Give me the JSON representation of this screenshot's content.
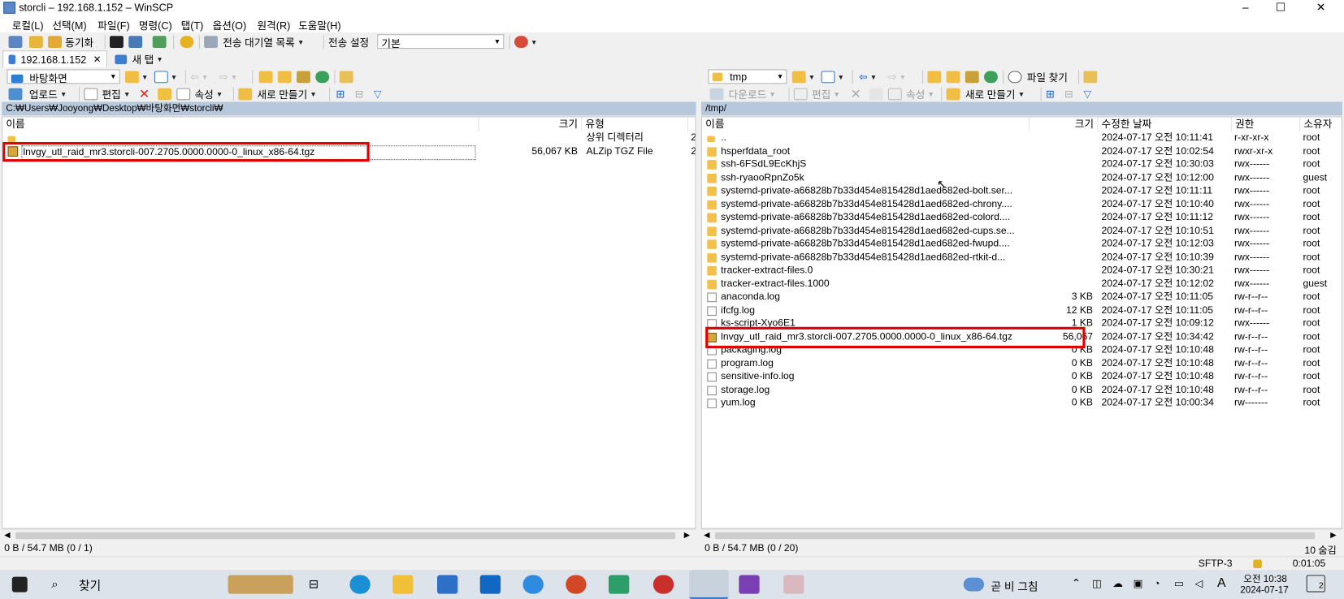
{
  "window": {
    "title": "storcli – 192.168.1.152 – WinSCP",
    "min": "–",
    "max": "☐",
    "close": "✕"
  },
  "menu": [
    "로컬(L)",
    "선택(M)",
    "파일(F)",
    "명령(C)",
    "탭(T)",
    "옵션(O)",
    "원격(R)",
    "도움말(H)"
  ],
  "toolbar": {
    "sync_label": "동기화",
    "queue_label": "전송 대기열 목록",
    "transfer_settings_label": "전송 설정",
    "transfer_settings_value": "기본"
  },
  "tabs": {
    "session": "192.168.1.152",
    "session_close": "✕",
    "new_tab": "새 탭"
  },
  "left": {
    "location": "바탕화면",
    "upload_label": "업로드",
    "edit_label": "편집",
    "properties_label": "속성",
    "new_label": "새로 만들기",
    "path": "C:₩Users₩Jooyong₩Desktop₩바탕화면₩storcli₩",
    "columns": {
      "name": "이름",
      "size": "크기",
      "type": "유형",
      "extra": ""
    },
    "rows": [
      {
        "name": "",
        "size": "",
        "type": "상위 디렉터리",
        "extra": "2",
        "icon": "parent"
      },
      {
        "name": "lnvgy_utl_raid_mr3.storcli-007.2705.0000.0000-0_linux_x86-64.tgz",
        "size": "56,067 KB",
        "type": "ALZip TGZ File",
        "extra": "2",
        "icon": "tgz"
      }
    ],
    "status": "0 B / 54.7 MB (0 / 1)"
  },
  "right": {
    "location": "tmp",
    "download_label": "다운로드",
    "edit_label": "편집",
    "properties_label": "속성",
    "new_label": "새로 만들기",
    "find_label": "파일 찾기",
    "path": "/tmp/",
    "columns": {
      "name": "이름",
      "size": "크기",
      "modified": "수정한 날짜",
      "rights": "권한",
      "owner": "소유자"
    },
    "rows": [
      {
        "name": "..",
        "size": "",
        "modified": "2024-07-17 오전 10:11:41",
        "rights": "r-xr-xr-x",
        "owner": "root",
        "icon": "parent"
      },
      {
        "name": "hsperfdata_root",
        "size": "",
        "modified": "2024-07-17 오전 10:02:54",
        "rights": "rwxr-xr-x",
        "owner": "root",
        "icon": "folder"
      },
      {
        "name": "ssh-6FSdL9EcKhjS",
        "size": "",
        "modified": "2024-07-17 오전 10:30:03",
        "rights": "rwx------",
        "owner": "root",
        "icon": "folder"
      },
      {
        "name": "ssh-ryaooRpnZo5k",
        "size": "",
        "modified": "2024-07-17 오전 10:12:00",
        "rights": "rwx------",
        "owner": "guest",
        "icon": "folder"
      },
      {
        "name": "systemd-private-a66828b7b33d454e815428d1aed682ed-bolt.ser...",
        "size": "",
        "modified": "2024-07-17 오전 10:11:11",
        "rights": "rwx------",
        "owner": "root",
        "icon": "folder"
      },
      {
        "name": "systemd-private-a66828b7b33d454e815428d1aed682ed-chrony....",
        "size": "",
        "modified": "2024-07-17 오전 10:10:40",
        "rights": "rwx------",
        "owner": "root",
        "icon": "folder"
      },
      {
        "name": "systemd-private-a66828b7b33d454e815428d1aed682ed-colord....",
        "size": "",
        "modified": "2024-07-17 오전 10:11:12",
        "rights": "rwx------",
        "owner": "root",
        "icon": "folder"
      },
      {
        "name": "systemd-private-a66828b7b33d454e815428d1aed682ed-cups.se...",
        "size": "",
        "modified": "2024-07-17 오전 10:10:51",
        "rights": "rwx------",
        "owner": "root",
        "icon": "folder"
      },
      {
        "name": "systemd-private-a66828b7b33d454e815428d1aed682ed-fwupd....",
        "size": "",
        "modified": "2024-07-17 오전 10:12:03",
        "rights": "rwx------",
        "owner": "root",
        "icon": "folder"
      },
      {
        "name": "systemd-private-a66828b7b33d454e815428d1aed682ed-rtkit-d...",
        "size": "",
        "modified": "2024-07-17 오전 10:10:39",
        "rights": "rwx------",
        "owner": "root",
        "icon": "folder"
      },
      {
        "name": "tracker-extract-files.0",
        "size": "",
        "modified": "2024-07-17 오전 10:30:21",
        "rights": "rwx------",
        "owner": "root",
        "icon": "folder"
      },
      {
        "name": "tracker-extract-files.1000",
        "size": "",
        "modified": "2024-07-17 오전 10:12:02",
        "rights": "rwx------",
        "owner": "guest",
        "icon": "folder"
      },
      {
        "name": "anaconda.log",
        "size": "3 KB",
        "modified": "2024-07-17 오전 10:11:05",
        "rights": "rw-r--r--",
        "owner": "root",
        "icon": "file"
      },
      {
        "name": "ifcfg.log",
        "size": "12 KB",
        "modified": "2024-07-17 오전 10:11:05",
        "rights": "rw-r--r--",
        "owner": "root",
        "icon": "file"
      },
      {
        "name": "ks-script-Xyo6E1",
        "size": "1 KB",
        "modified": "2024-07-17 오전 10:09:12",
        "rights": "rwx------",
        "owner": "root",
        "icon": "file"
      },
      {
        "name": "lnvgy_utl_raid_mr3.storcli-007.2705.0000.0000-0_linux_x86-64.tgz",
        "size": "56,067",
        "modified": "2024-07-17 오전 10:34:42",
        "rights": "rw-r--r--",
        "owner": "root",
        "icon": "tgz"
      },
      {
        "name": "packaging.log",
        "size": "0 KB",
        "modified": "2024-07-17 오전 10:10:48",
        "rights": "rw-r--r--",
        "owner": "root",
        "icon": "file"
      },
      {
        "name": "program.log",
        "size": "0 KB",
        "modified": "2024-07-17 오전 10:10:48",
        "rights": "rw-r--r--",
        "owner": "root",
        "icon": "file"
      },
      {
        "name": "sensitive-info.log",
        "size": "0 KB",
        "modified": "2024-07-17 오전 10:10:48",
        "rights": "rw-r--r--",
        "owner": "root",
        "icon": "file"
      },
      {
        "name": "storage.log",
        "size": "0 KB",
        "modified": "2024-07-17 오전 10:10:48",
        "rights": "rw-r--r--",
        "owner": "root",
        "icon": "file"
      },
      {
        "name": "yum.log",
        "size": "0 KB",
        "modified": "2024-07-17 오전 10:00:34",
        "rights": "rw-------",
        "owner": "root",
        "icon": "file"
      }
    ],
    "status": "0 B / 54.7 MB (0 / 20)",
    "hidden": "10 숨김"
  },
  "statusbar": {
    "protocol": "SFTP-3",
    "elapsed": "0:01:05"
  },
  "taskbar": {
    "search_label": "찾기",
    "weather": "곧 비 그침",
    "ime": "A",
    "time": "오전 10:38",
    "date": "2024-07-17",
    "notifications": "2"
  },
  "colors": {
    "highlight_box": "#e00000",
    "path_bar": "#b7c8dd",
    "folder": "#f3c04b"
  }
}
